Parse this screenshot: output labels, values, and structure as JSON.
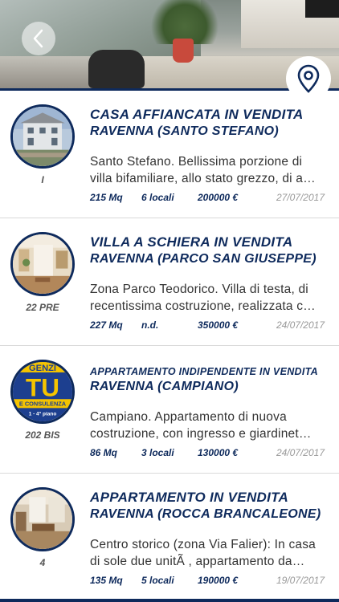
{
  "header": {
    "back_icon": "chevron-left-icon",
    "map_icon": "location-pin-icon"
  },
  "listings": [
    {
      "title": "CASA AFFIANCATA  IN  VENDITA",
      "title_size": "normal",
      "city": "RAVENNA (SANTO STEFANO)",
      "ref": "I",
      "description": "Santo Stefano. Bellissima porzione di villa bifamiliare, allo stato grezzo, di a…",
      "mq": "215 Mq",
      "locali": "6 locali",
      "price": "200000 €",
      "date": "27/07/2017"
    },
    {
      "title": "VILLA A SCHIERA  IN  VENDITA",
      "title_size": "normal",
      "city": "RAVENNA (PARCO SAN GIUSEPPE)",
      "ref": "22 PRE",
      "description": "Zona Parco Teodorico. Villa di testa, di recentissima costruzione, realizzata c…",
      "mq": "227 Mq",
      "locali": "n.d.",
      "price": "350000 €",
      "date": "24/07/2017"
    },
    {
      "title": "APPARTAMENTO INDIPENDENTE  IN  VENDITA",
      "title_size": "small",
      "city": "RAVENNA (CAMPIANO)",
      "ref": "202 BIS",
      "description": "Campiano. Appartamento di nuova costruzione, con ingresso e giardinet…",
      "mq": "86 Mq",
      "locali": "3 locali",
      "price": "130000 €",
      "date": "24/07/2017"
    },
    {
      "title": "APPARTAMENTO  IN  VENDITA",
      "title_size": "normal",
      "city": "RAVENNA (ROCCA BRANCALEONE)",
      "ref": "4",
      "description": "Centro storico (zona Via Falier): In casa di sole due unitÃ , appartamento da…",
      "mq": "135 Mq",
      "locali": "5 locali",
      "price": "190000 €",
      "date": "19/07/2017"
    }
  ],
  "logo_text": {
    "line1": "GENZI",
    "line2": "TU",
    "line3": "E CONSULENZA",
    "line4": "1 - 4° piano"
  },
  "colors": {
    "navy": "#0e2a5c",
    "text": "#333333",
    "date": "#999999",
    "divider": "#d9d9d9"
  }
}
